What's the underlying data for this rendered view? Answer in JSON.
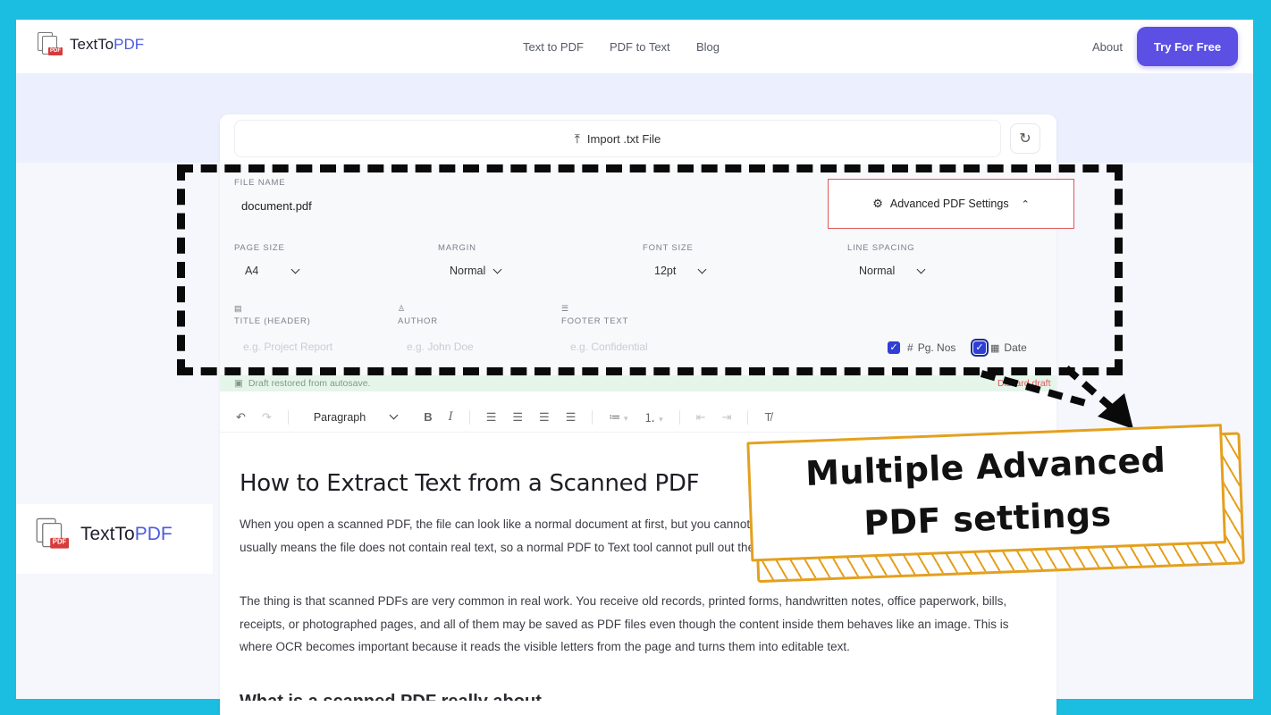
{
  "brand": {
    "name_part1": "TextTo",
    "name_part2": "PDF",
    "accent_color": "#4b5ae0",
    "logo_icon": "pdf-documents-icon"
  },
  "nav": {
    "links": [
      "Text to PDF",
      "PDF to Text",
      "Blog"
    ],
    "about": "About",
    "cta": "Try For Free",
    "cta_color": "#5b4fe4"
  },
  "import": {
    "label": "Import .txt File",
    "icon": "upload-icon",
    "refresh_icon": "refresh-icon"
  },
  "settings": {
    "file_name_label": "FILE NAME",
    "file_name_value": "document.pdf",
    "advanced_button": "Advanced PDF Settings",
    "page_size": {
      "label": "PAGE SIZE",
      "value": "A4"
    },
    "margin": {
      "label": "MARGIN",
      "value": "Normal"
    },
    "font_size": {
      "label": "FONT SIZE",
      "value": "12pt"
    },
    "line_spacing": {
      "label": "LINE SPACING",
      "value": "Normal"
    },
    "title_header": {
      "label": "TITLE (HEADER)",
      "placeholder": "e.g. Project Report"
    },
    "author": {
      "label": "AUTHOR",
      "placeholder": "e.g. John Doe"
    },
    "footer_text": {
      "label": "FOOTER TEXT",
      "placeholder": "e.g. Confidential"
    },
    "page_numbers": {
      "label": "Pg. Nos",
      "prefix": "#",
      "checked": true
    },
    "date": {
      "label": "Date",
      "checked": true
    }
  },
  "draft": {
    "status": "Draft restored from autosave.",
    "discard": "Discard draft"
  },
  "toolbar": {
    "block_format": "Paragraph",
    "bold": "B",
    "italic": "I"
  },
  "document": {
    "title": "How to Extract Text from a Scanned PDF",
    "p1": "When you open a scanned PDF, the file can look like a normal document at first, but you cannot select the words and nothing gets highlighted. That usually means the file does not contain real text, so a normal PDF to Text tool cannot pull out the content in a usable form.",
    "p2": "The thing is that scanned PDFs are very common in real work. You receive old records, printed forms, handwritten notes, office paperwork, bills, receipts, or photographed pages, and all of them may be saved as PDF files even though the content inside them behaves like an image. This is where OCR becomes important because it reads the visible letters from the page and turns them into editable text.",
    "next_heading": "What is a scanned PDF really about"
  },
  "callout": {
    "line1": "Multiple Advanced",
    "line2": "PDF settings",
    "border_color": "#e4a01e"
  }
}
